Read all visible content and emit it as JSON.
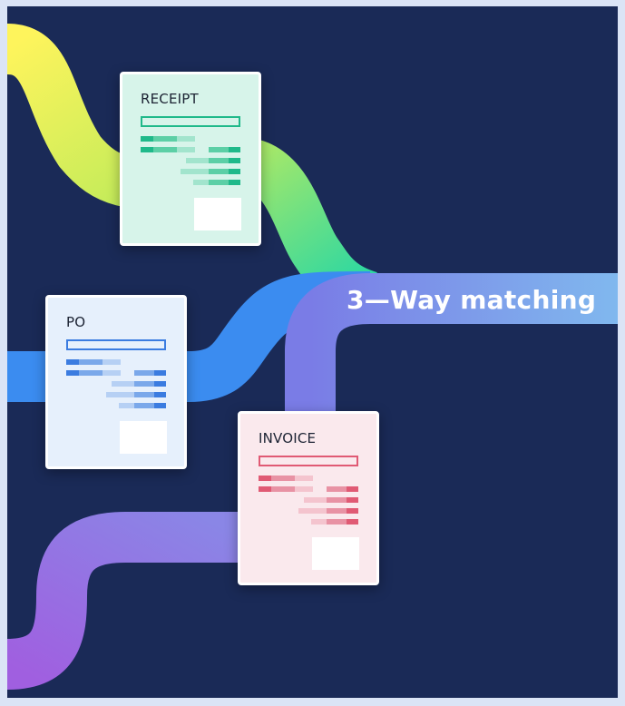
{
  "title": "3—Way matching",
  "documents": {
    "receipt": {
      "title": "RECEIPT",
      "accent": "#1fb98a",
      "light": "#88dcbf",
      "paper": "#d7f4ea"
    },
    "po": {
      "title": "PO",
      "accent": "#3b7ce0",
      "light": "#9cc0f0",
      "paper": "#e6f0fc"
    },
    "invoice": {
      "title": "INVOICE",
      "accent": "#e05a74",
      "light": "#f2b3c0",
      "paper": "#fae9ed"
    }
  },
  "colors": {
    "background": "#1a2a57",
    "flow_receipt": [
      "#fdf35a",
      "#1fd6a8"
    ],
    "flow_po": "#3b8cf0",
    "flow_invoice": [
      "#9b62e0",
      "#8a80e8"
    ],
    "flow_main": [
      "#7a7fe6",
      "#7fb3ee"
    ]
  }
}
